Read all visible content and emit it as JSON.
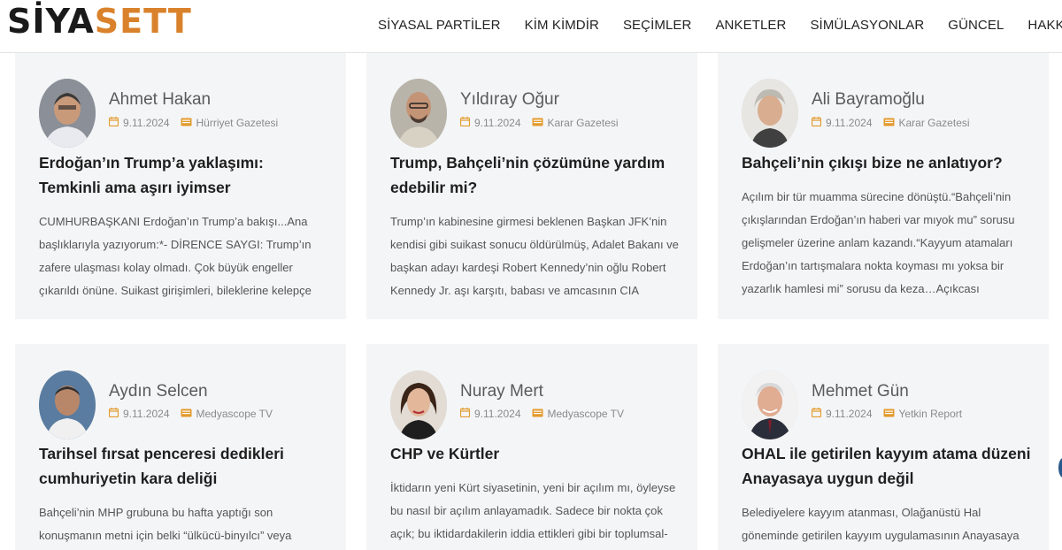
{
  "site": {
    "logo_part1": "SİYA",
    "logo_part2": "SETT"
  },
  "nav": [
    "SİYASAL PARTİLER",
    "KİM KİMDİR",
    "SEÇİMLER",
    "ANKETLER",
    "SİMÜLASYONLAR",
    "GÜNCEL",
    "HAKKIMIZDA"
  ],
  "colors": {
    "accent": "#d9822b",
    "card_bg": "#f4f5f7",
    "meta_icon": "#e39a2c"
  },
  "icons": {
    "date": "calendar-icon",
    "source": "newspaper-icon"
  },
  "cards": [
    {
      "author": "Ahmet Hakan",
      "date": "9.11.2024",
      "source": "Hürriyet Gazetesi",
      "title": "Erdoğan’ın Trump’a yaklaşımı: Temkinli ama aşırı iyimser",
      "excerpt": "CUMHURBAŞKANI Erdoğan’ın Trump’a bakışı...Ana başlıklarıyla yazıyorum:*- DİRENCE SAYGI: Trump’ın zafere ulaşması kolay olmadı. Çok büyük engeller çıkarıldı önüne. Suikast girişimleri, bileklerine kelepçe vurulması"
    },
    {
      "author": "Yıldıray Oğur",
      "date": "9.11.2024",
      "source": "Karar Gazetesi",
      "title": "Trump, Bahçeli’nin çözümüne yardım edebilir mi?",
      "excerpt": "Trump’ın kabinesine girmesi beklenen Başkan JFK’nin kendisi gibi suikast sonucu öldürülmüş, Adalet Bakanı ve başkan adayı kardeşi Robert Kennedy’nin oğlu Robert Kennedy Jr. aşı karşıtı, babası ve amcasının CIA"
    },
    {
      "author": "Ali Bayramoğlu",
      "date": "9.11.2024",
      "source": "Karar Gazetesi",
      "title": "Bahçeli’nin çıkışı bize ne anlatıyor?",
      "excerpt": "Açılım bir tür muamma sürecine dönüştü.“Bahçeli’nin çıkışlarından Erdoğan’ın haberi var mıyok mu” sorusu gelişmeler üzerine anlam kazandı.“Kayyum atamaları Erdoğan’ın tartışmalara nokta koyması mı yoksa bir yazarlık hamlesi mi” sorusu da keza…Açıkcası Bahçeli’nin"
    },
    {
      "author": "Aydın Selcen",
      "date": "9.11.2024",
      "source": "Medyascope TV",
      "title": "Tarihsel fırsat penceresi dedikleri cumhuriyetin kara deliği",
      "excerpt": "Bahçeli’nin MHP grubuna bu hafta yaptığı son konuşmanın metni için belki “ülkücü-binyılcı” veya"
    },
    {
      "author": "Nuray Mert",
      "date": "9.11.2024",
      "source": "Medyascope TV",
      "title": "CHP ve Kürtler",
      "excerpt": "İktidarın yeni Kürt siyasetinin, yeni bir açılım mı, öyleyse bu nasıl bir açılım anlayamadık. Sadece bir nokta çok açık; bu iktidardakilerin iddia ettikleri gibi bir toplumsal-"
    },
    {
      "author": "Mehmet Gün",
      "date": "9.11.2024",
      "source": "Yetkin Report",
      "title": "OHAL ile getirilen kayyım atama düzeni Anayasaya uygun değil",
      "excerpt": "Belediyelere kayyım atanması, Olağanüstü Hal göneminde getirilen kayyım uygulamasının Anayasaya"
    }
  ]
}
